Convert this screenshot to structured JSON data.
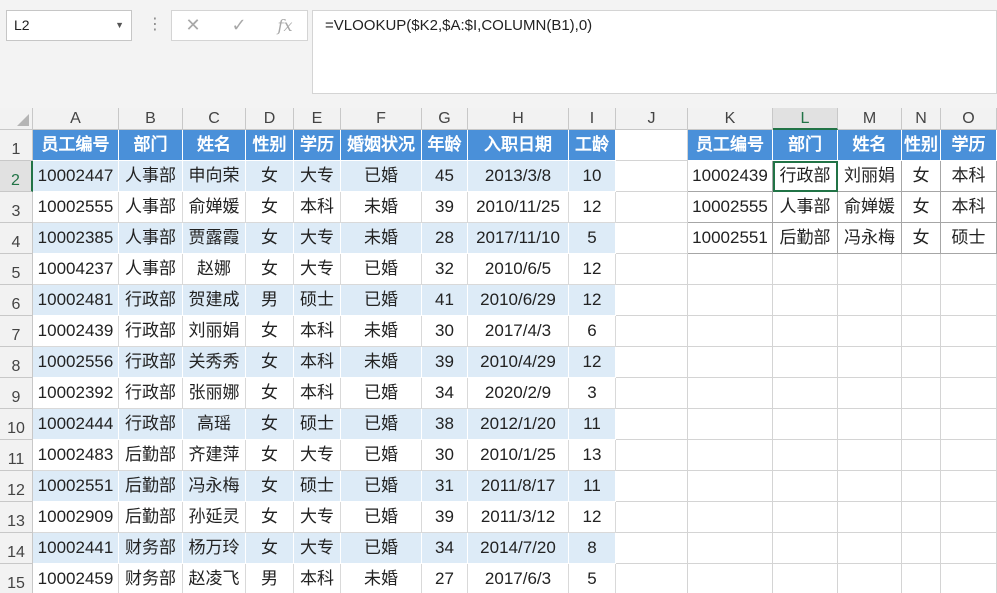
{
  "name_box": "L2",
  "formula": "=VLOOKUP($K2,$A:$I,COLUMN(B1),0)",
  "icons": {
    "cancel": "✕",
    "enter": "✓",
    "fx": "fx"
  },
  "columns": [
    "A",
    "B",
    "C",
    "D",
    "E",
    "F",
    "G",
    "H",
    "I",
    "J",
    "K",
    "L",
    "M",
    "N",
    "O"
  ],
  "rows": [
    "1",
    "2",
    "3",
    "4",
    "5",
    "6",
    "7",
    "8",
    "9",
    "10",
    "11",
    "12",
    "13",
    "14",
    "15"
  ],
  "main_table": {
    "headers": [
      "员工编号",
      "部门",
      "姓名",
      "性别",
      "学历",
      "婚姻状况",
      "年龄",
      "入职日期",
      "工龄"
    ],
    "rows": [
      [
        "10002447",
        "人事部",
        "申向荣",
        "女",
        "大专",
        "已婚",
        "45",
        "2013/3/8",
        "10"
      ],
      [
        "10002555",
        "人事部",
        "俞婵媛",
        "女",
        "本科",
        "未婚",
        "39",
        "2010/11/25",
        "12"
      ],
      [
        "10002385",
        "人事部",
        "贾露霞",
        "女",
        "大专",
        "未婚",
        "28",
        "2017/11/10",
        "5"
      ],
      [
        "10004237",
        "人事部",
        "赵娜",
        "女",
        "大专",
        "已婚",
        "32",
        "2010/6/5",
        "12"
      ],
      [
        "10002481",
        "行政部",
        "贺建成",
        "男",
        "硕士",
        "已婚",
        "41",
        "2010/6/29",
        "12"
      ],
      [
        "10002439",
        "行政部",
        "刘丽娟",
        "女",
        "本科",
        "未婚",
        "30",
        "2017/4/3",
        "6"
      ],
      [
        "10002556",
        "行政部",
        "关秀秀",
        "女",
        "本科",
        "未婚",
        "39",
        "2010/4/29",
        "12"
      ],
      [
        "10002392",
        "行政部",
        "张丽娜",
        "女",
        "本科",
        "已婚",
        "34",
        "2020/2/9",
        "3"
      ],
      [
        "10002444",
        "行政部",
        "高瑶",
        "女",
        "硕士",
        "已婚",
        "38",
        "2012/1/20",
        "11"
      ],
      [
        "10002483",
        "后勤部",
        "齐建萍",
        "女",
        "大专",
        "已婚",
        "30",
        "2010/1/25",
        "13"
      ],
      [
        "10002551",
        "后勤部",
        "冯永梅",
        "女",
        "硕士",
        "已婚",
        "31",
        "2011/8/17",
        "11"
      ],
      [
        "10002909",
        "后勤部",
        "孙延灵",
        "女",
        "大专",
        "已婚",
        "39",
        "2011/3/12",
        "12"
      ],
      [
        "10002441",
        "财务部",
        "杨万玲",
        "女",
        "大专",
        "已婚",
        "34",
        "2014/7/20",
        "8"
      ],
      [
        "10002459",
        "财务部",
        "赵凌飞",
        "男",
        "本科",
        "未婚",
        "27",
        "2017/6/3",
        "5"
      ]
    ]
  },
  "lookup_table": {
    "headers": [
      "员工编号",
      "部门",
      "姓名",
      "性别",
      "学历"
    ],
    "rows": [
      [
        "10002439",
        "行政部",
        "刘丽娟",
        "女",
        "本科"
      ],
      [
        "10002555",
        "人事部",
        "俞婵媛",
        "女",
        "本科"
      ],
      [
        "10002551",
        "后勤部",
        "冯永梅",
        "女",
        "硕士"
      ]
    ]
  }
}
